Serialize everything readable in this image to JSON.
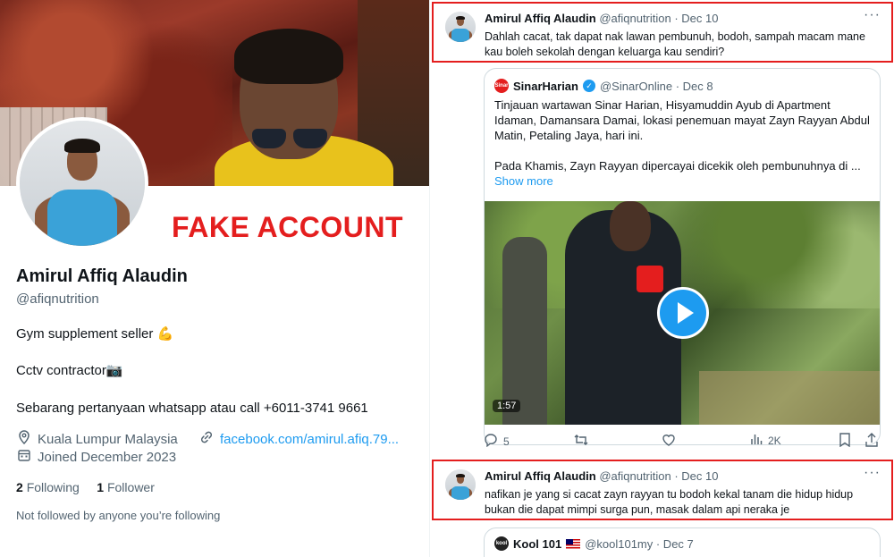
{
  "annotation": {
    "label": "FAKE ACCOUNT",
    "color": "#e41e1e"
  },
  "profile": {
    "name": "Amirul Affiq Alaudin",
    "handle": "@afiqnutrition",
    "bio_line1": "Gym supplement seller 💪",
    "bio_line2": "Cctv contractor📷",
    "bio_line3": "Sebarang pertanyaan whatsapp atau call +6011-3741 9661",
    "location": "Kuala Lumpur Malaysia",
    "link": "facebook.com/amirul.afiq.79...",
    "joined": "Joined December 2023",
    "following_count": "2",
    "following_label": "Following",
    "followers_count": "1",
    "followers_label": "Follower",
    "not_followed": "Not followed by anyone you’re following"
  },
  "tweets": [
    {
      "name": "Amirul Affiq Alaudin",
      "handle_date": "@afiqnutrition · Dec 10",
      "text": "Dahlah cacat, tak dapat nak lawan pembunuh, bodoh, sampah macam mane kau boleh sekolah dengan keluarga kau sendiri?"
    },
    {
      "name": "Amirul Affiq Alaudin",
      "handle_date": "@afiqnutrition · Dec 10",
      "text": "nafikan je yang si cacat zayn rayyan tu bodoh kekal tanam die hidup hidup bukan die dapat mimpi surga pun, masak dalam api neraka je"
    }
  ],
  "quoted_tweet": {
    "logo_text": "Sinar",
    "name": "SinarHarian",
    "handle_date": "@SinarOnline · Dec 8",
    "text_para1": "Tinjauan wartawan Sinar Harian, Hisyamuddin Ayub di Apartment Idaman, Damansara Damai, lokasi penemuan mayat Zayn Rayyan Abdul Matin, Petaling Jaya, hari ini.",
    "text_para2": "Pada Khamis, Zayn Rayyan dipercayai dicekik oleh pembunuhnya di ...",
    "show_more": "Show more",
    "video_duration": "1:57"
  },
  "actions": {
    "replies": "5",
    "views": "2K"
  },
  "quoted_tweet2": {
    "logo_text": "kool",
    "name": "Kool 101",
    "handle_date": "@kool101my · Dec 7"
  },
  "icons": {
    "more": "more-icon",
    "location": "location-icon",
    "link": "link-icon",
    "calendar": "calendar-icon"
  }
}
